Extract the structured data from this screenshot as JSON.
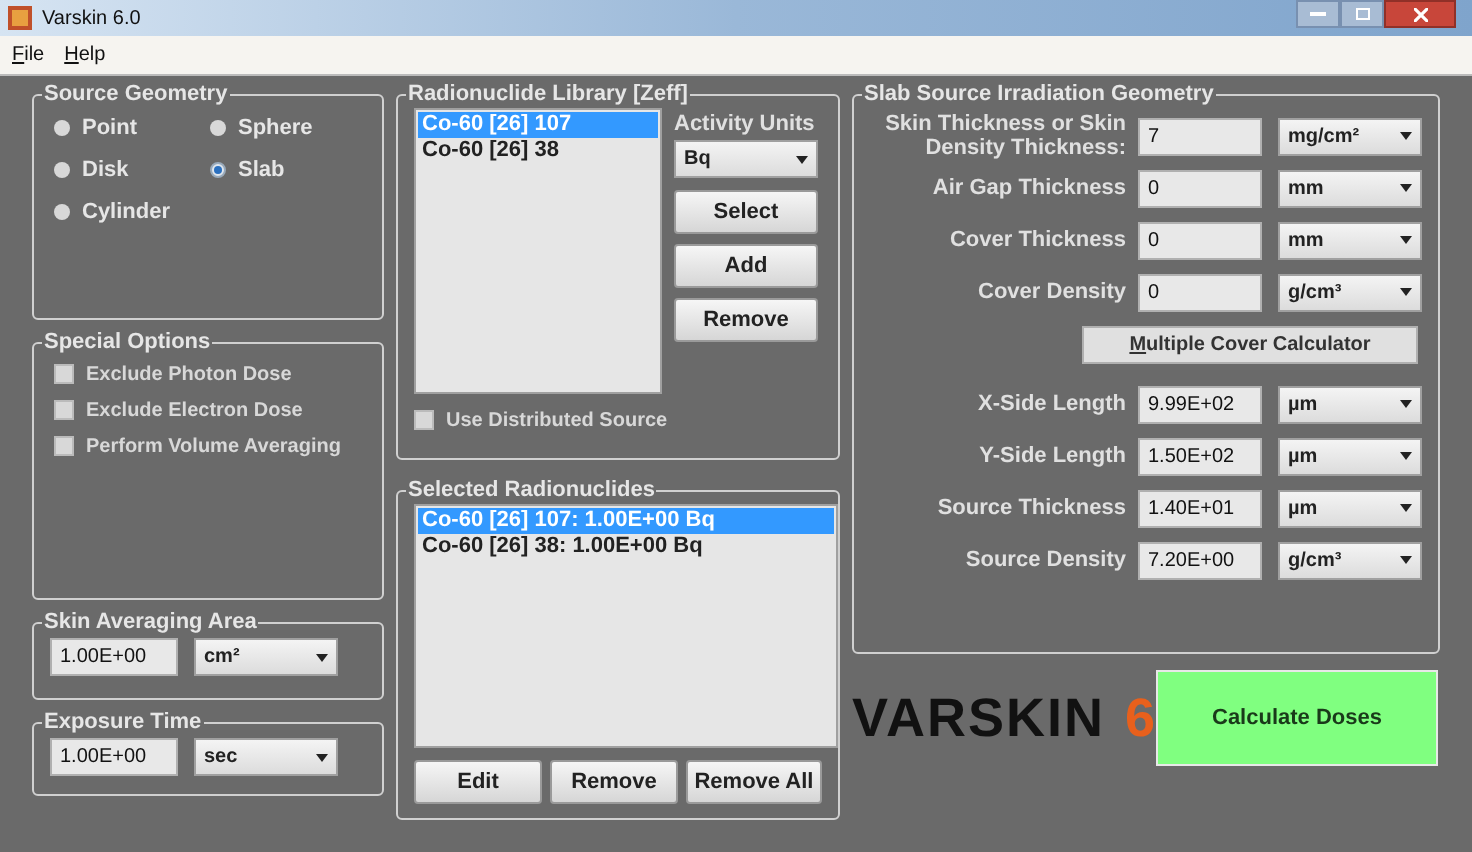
{
  "window": {
    "title": "Varskin 6.0"
  },
  "menu": [
    "File",
    "Help"
  ],
  "source_geometry": {
    "title": "Source Geometry",
    "options": [
      {
        "label": "Point",
        "selected": false
      },
      {
        "label": "Sphere",
        "selected": false
      },
      {
        "label": "Disk",
        "selected": false
      },
      {
        "label": "Slab",
        "selected": true
      },
      {
        "label": "Cylinder",
        "selected": false
      }
    ]
  },
  "special_options": {
    "title": "Special Options",
    "options": [
      {
        "label": "Exclude Photon Dose",
        "checked": false
      },
      {
        "label": "Exclude Electron Dose",
        "checked": false
      },
      {
        "label": "Perform Volume Averaging",
        "checked": false
      }
    ]
  },
  "skin_averaging_area": {
    "title": "Skin Averaging Area",
    "value": "1.00E+00",
    "unit": "cm²"
  },
  "exposure_time": {
    "title": "Exposure Time",
    "value": "1.00E+00",
    "unit": "sec"
  },
  "library": {
    "title": "Radionuclide Library [Zeff]",
    "items": [
      {
        "label": "Co-60 [26] 107",
        "selected": true
      },
      {
        "label": "Co-60 [26] 38",
        "selected": false
      }
    ],
    "activity_units_label": "Activity Units",
    "activity_units": "Bq",
    "buttons": [
      "Select",
      "Add",
      "Remove"
    ],
    "distributed_source": {
      "label": "Use Distributed Source",
      "checked": false
    }
  },
  "selected_radionuclides": {
    "title": "Selected Radionuclides",
    "items": [
      {
        "label": "Co-60 [26] 107: 1.00E+00 Bq",
        "selected": true
      },
      {
        "label": "Co-60 [26] 38: 1.00E+00 Bq",
        "selected": false
      }
    ],
    "buttons": [
      "Edit",
      "Remove",
      "Remove All"
    ]
  },
  "slab_geometry": {
    "title": "Slab Source Irradiation Geometry",
    "fields_top": [
      {
        "label": "Skin Thickness or Skin Density Thickness:",
        "value": "7",
        "unit": "mg/cm²"
      },
      {
        "label": "Air Gap Thickness",
        "value": "0",
        "unit": "mm"
      },
      {
        "label": "Cover Thickness",
        "value": "0",
        "unit": "mm"
      },
      {
        "label": "Cover Density",
        "value": "0",
        "unit": "g/cm³"
      }
    ],
    "calculator_button": "Multiple Cover Calculator",
    "fields_bottom": [
      {
        "label": "X-Side Length",
        "value": "9.99E+02",
        "unit": "µm"
      },
      {
        "label": "Y-Side Length",
        "value": "1.50E+02",
        "unit": "µm"
      },
      {
        "label": "Source Thickness",
        "value": "1.40E+01",
        "unit": "µm"
      },
      {
        "label": "Source Density",
        "value": "7.20E+00",
        "unit": "g/cm³"
      }
    ]
  },
  "logo": {
    "name": "VARSKIN",
    "version": "6"
  },
  "calculate_button": "Calculate Doses"
}
